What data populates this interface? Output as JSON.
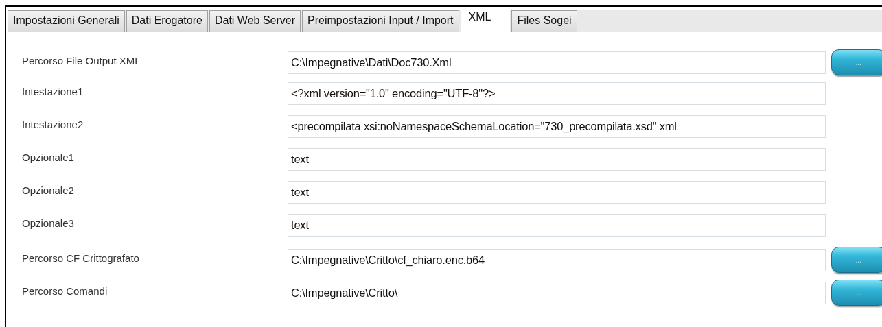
{
  "tabs": [
    {
      "label": "Impostazioni Generali",
      "selected": false
    },
    {
      "label": "Dati Erogatore",
      "selected": false
    },
    {
      "label": "Dati Web Server",
      "selected": false
    },
    {
      "label": "Preimpostazioni Input / Import",
      "selected": false
    },
    {
      "label": "XML",
      "selected": true
    },
    {
      "label": "Files Sogei",
      "selected": false
    }
  ],
  "fields": [
    {
      "label": "Percorso File Output XML",
      "value": "C:\\Impegnative\\Dati\\Doc730.Xml",
      "browse": "..."
    },
    {
      "label": "Intestazione1",
      "value": "<?xml version=\"1.0\" encoding=\"UTF-8\"?>"
    },
    {
      "label": "Intestazione2",
      "value": "<precompilata xsi:noNamespaceSchemaLocation=\"730_precompilata.xsd\" xml"
    },
    {
      "label": "Opzionale1",
      "value": "text"
    },
    {
      "label": "Opzionale2",
      "value": "text"
    },
    {
      "label": "Opzionale3",
      "value": "text"
    },
    {
      "label": "Percorso CF Crittografato",
      "value": "C:\\Impegnative\\Critto\\cf_chiaro.enc.b64",
      "browse": "..."
    },
    {
      "label": "Percorso Comandi",
      "value": "C:\\Impegnative\\Critto\\",
      "browse": "..."
    }
  ]
}
